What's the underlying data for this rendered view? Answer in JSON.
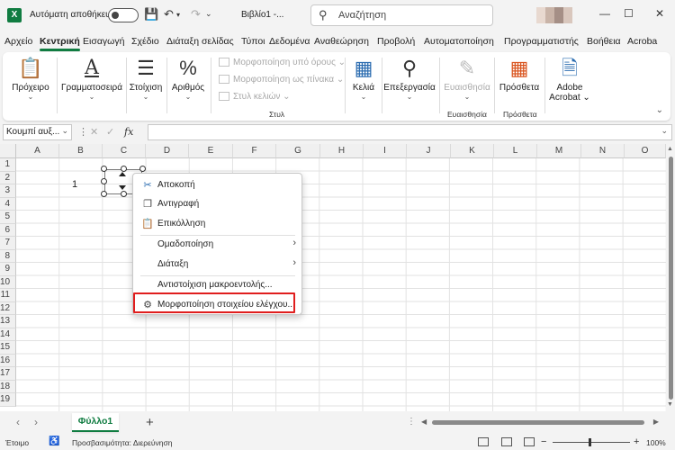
{
  "titlebar": {
    "app_icon": "X",
    "autosave_label": "Αυτόματη αποθήκευση",
    "doc_title": "Βιβλίο1 -...",
    "search_placeholder": "Αναζήτηση",
    "minimize": "—",
    "maximize": "☐",
    "close": "✕"
  },
  "menu": {
    "items": [
      "Αρχείο",
      "Κεντρική",
      "Εισαγωγή",
      "Σχέδιο",
      "Διάταξη σελίδας",
      "Τύποι",
      "Δεδομένα",
      "Αναθεώρηση",
      "Προβολή",
      "Αυτοματοποίηση",
      "Προγραμματιστής",
      "Βοήθεια",
      "Acroba"
    ],
    "active_index": 1
  },
  "ribbon": {
    "clipboard": "Πρόχειρο",
    "font": "Γραμματοσειρά",
    "alignment": "Στοίχιση",
    "number": "Αριθμός",
    "conditional_formatting": "Μορφοποίηση υπό όρους",
    "format_as_table": "Μορφοποίηση ως πίνακα",
    "cell_styles": "Στυλ κελιών",
    "styles_caption": "Στυλ",
    "cells": "Κελιά",
    "editing": "Επεξεργασία",
    "sensitivity": "Ευαισθησία",
    "sensitivity_caption": "Ευαισθησία",
    "addins": "Πρόσθετα",
    "addins_caption": "Πρόσθετα",
    "adobe_line1": "Adobe",
    "adobe_line2": "Acrobat"
  },
  "formula_bar": {
    "name_box": "Κουμπί αυξ...",
    "fx": "fx",
    "value": ""
  },
  "grid": {
    "columns": [
      "A",
      "B",
      "C",
      "D",
      "E",
      "F",
      "G",
      "H",
      "I",
      "J",
      "K",
      "L",
      "M",
      "N",
      "O"
    ],
    "rows": [
      "1",
      "2",
      "3",
      "4",
      "5",
      "6",
      "7",
      "8",
      "9",
      "10",
      "11",
      "12",
      "13",
      "14",
      "15",
      "16",
      "17",
      "18",
      "19"
    ],
    "cell_b3": "1"
  },
  "context_menu": {
    "cut": "Αποκοπή",
    "copy": "Αντιγραφή",
    "paste": "Επικόλληση",
    "group": "Ομαδοποίηση",
    "order": "Διάταξη",
    "assign_macro": "Αντιστοίχιση μακροεντολής...",
    "format_control": "Μορφοποίηση στοιχείου ελέγχου..."
  },
  "sheets": {
    "tabs": [
      "Φύλλο1"
    ],
    "add": "+"
  },
  "status": {
    "ready": "Έτοιμο",
    "accessibility": "Προσβασιμότητα: Διερεύνηση",
    "zoom": "100%"
  },
  "colors": {
    "brand": "#107c41",
    "highlight": "#e01e1e"
  }
}
